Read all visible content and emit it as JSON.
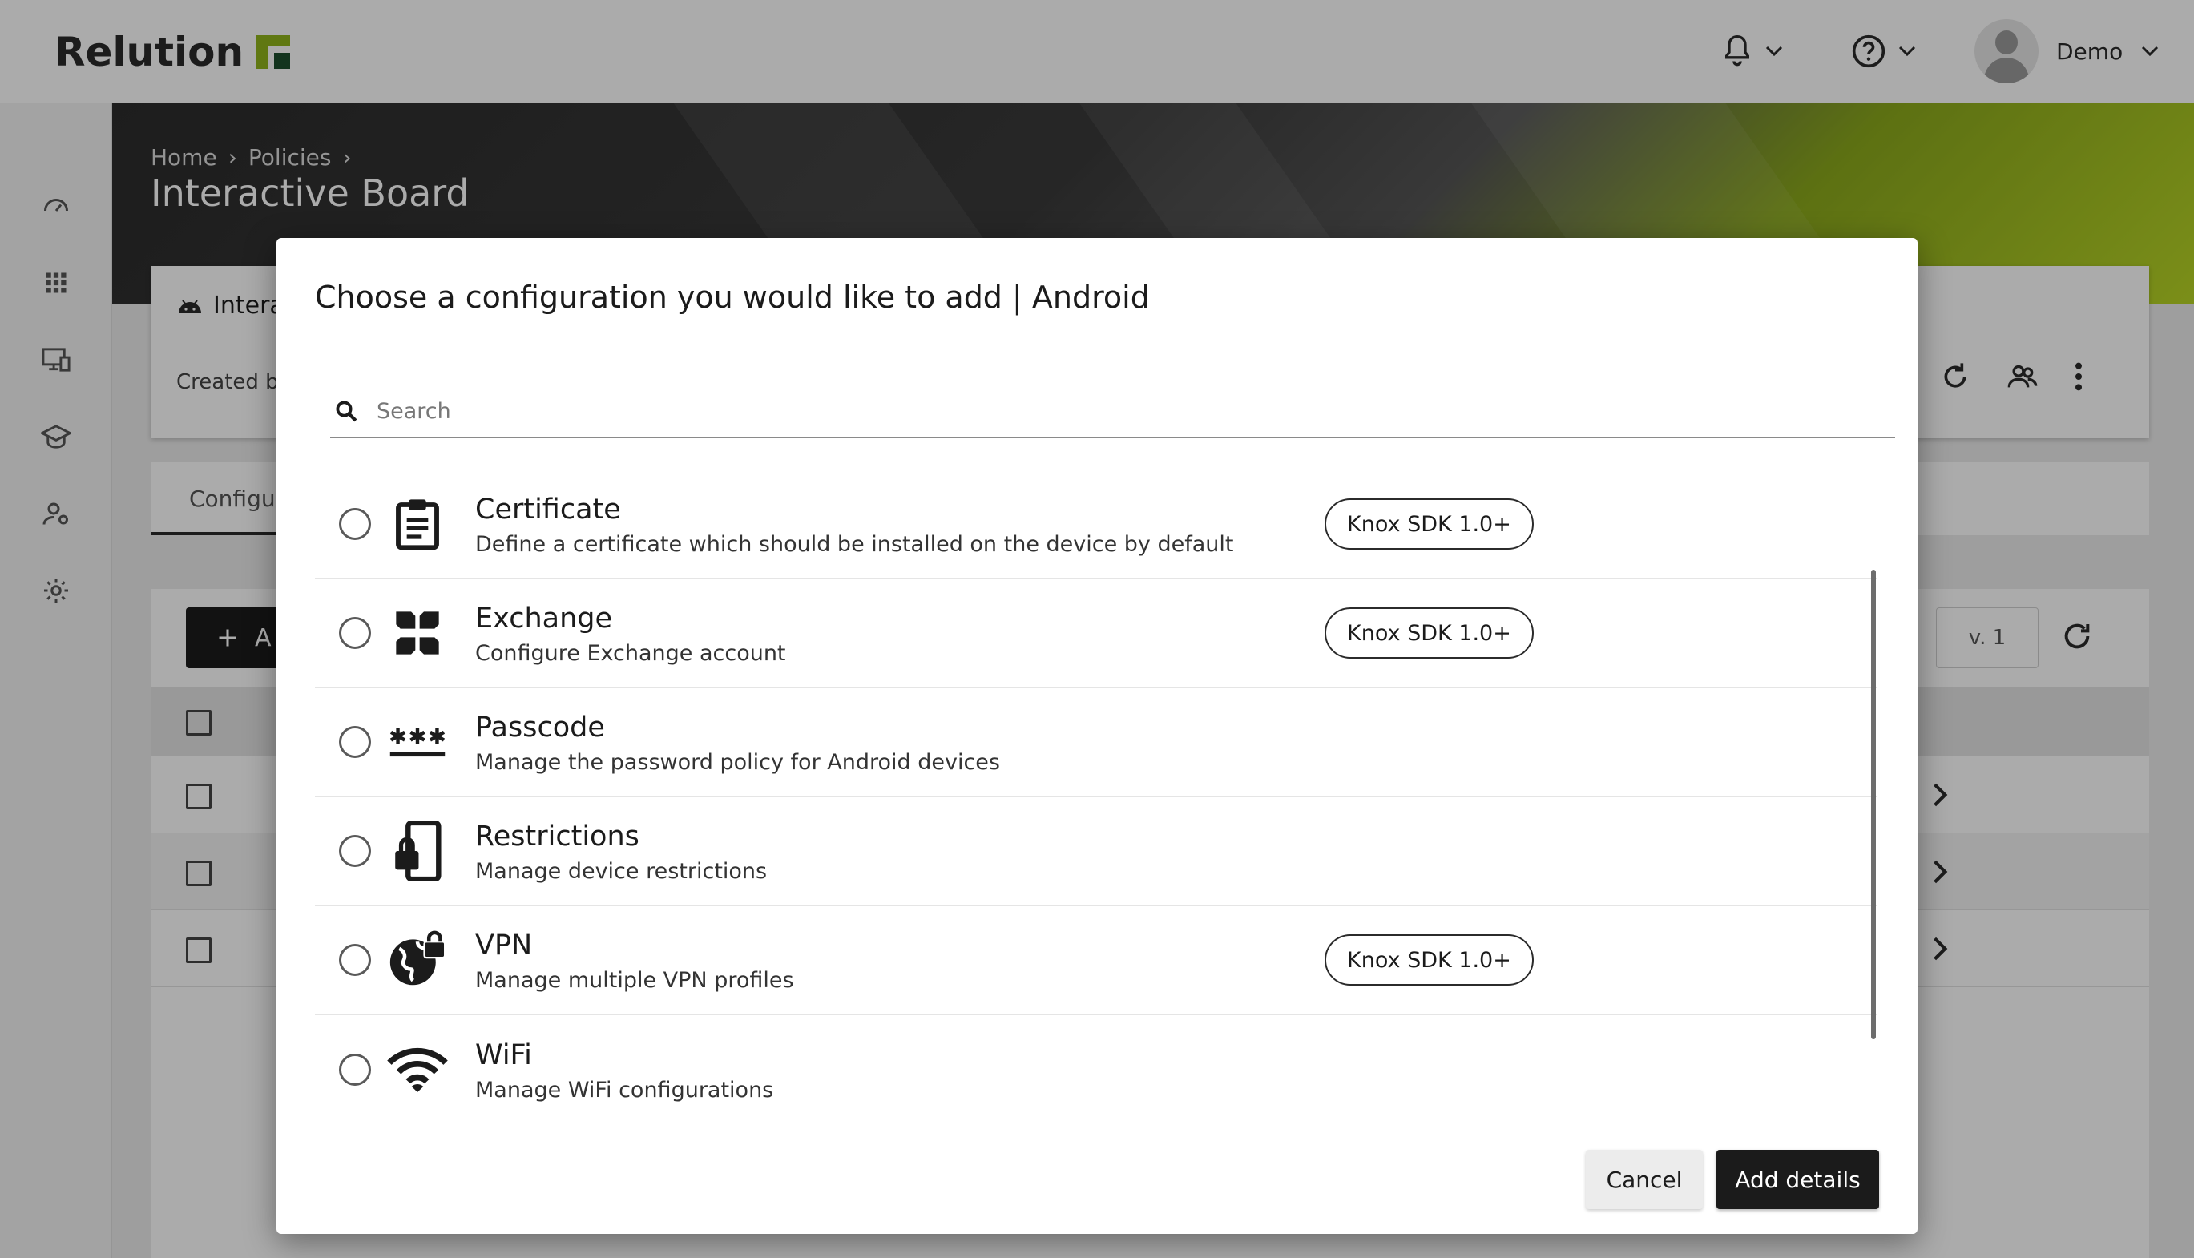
{
  "app": {
    "logo_text": "Relution",
    "brand_color": "#8fb31b",
    "brand_dark": "#1d4e2e"
  },
  "topbar": {
    "bell_icon": "bell-icon",
    "help_icon": "help-icon",
    "user_name": "Demo"
  },
  "sidebar": {
    "items": [
      {
        "icon": "dashboard-icon"
      },
      {
        "icon": "apps-icon"
      },
      {
        "icon": "devices-icon"
      },
      {
        "icon": "education-icon"
      },
      {
        "icon": "users-icon"
      },
      {
        "icon": "settings-icon"
      }
    ]
  },
  "page": {
    "breadcrumb": [
      "Home",
      "Policies"
    ],
    "title": "Interactive Board",
    "card_title": "Intera",
    "card_sub": "Created by",
    "tab_label": "Configur",
    "add_label": "A",
    "version": "v. 1"
  },
  "dialog": {
    "title": "Choose a configuration you would like to add | Android",
    "search_placeholder": "Search",
    "items": [
      {
        "title": "Certificate",
        "desc": "Define a certificate which should be installed on the device by default",
        "badge": "Knox SDK 1.0+",
        "icon": "clipboard-icon"
      },
      {
        "title": "Exchange",
        "desc": "Configure Exchange account",
        "badge": "Knox SDK 1.0+",
        "icon": "exchange-icon"
      },
      {
        "title": "Passcode",
        "desc": "Manage the password policy for Android devices",
        "badge": "",
        "icon": "passcode-icon"
      },
      {
        "title": "Restrictions",
        "desc": "Manage device restrictions",
        "badge": "",
        "icon": "device-lock-icon"
      },
      {
        "title": "VPN",
        "desc": "Manage multiple VPN profiles",
        "badge": "Knox SDK 1.0+",
        "icon": "globe-lock-icon"
      },
      {
        "title": "WiFi",
        "desc": "Manage WiFi configurations",
        "badge": "",
        "icon": "wifi-icon"
      }
    ],
    "cancel_label": "Cancel",
    "add_details_label": "Add details"
  }
}
